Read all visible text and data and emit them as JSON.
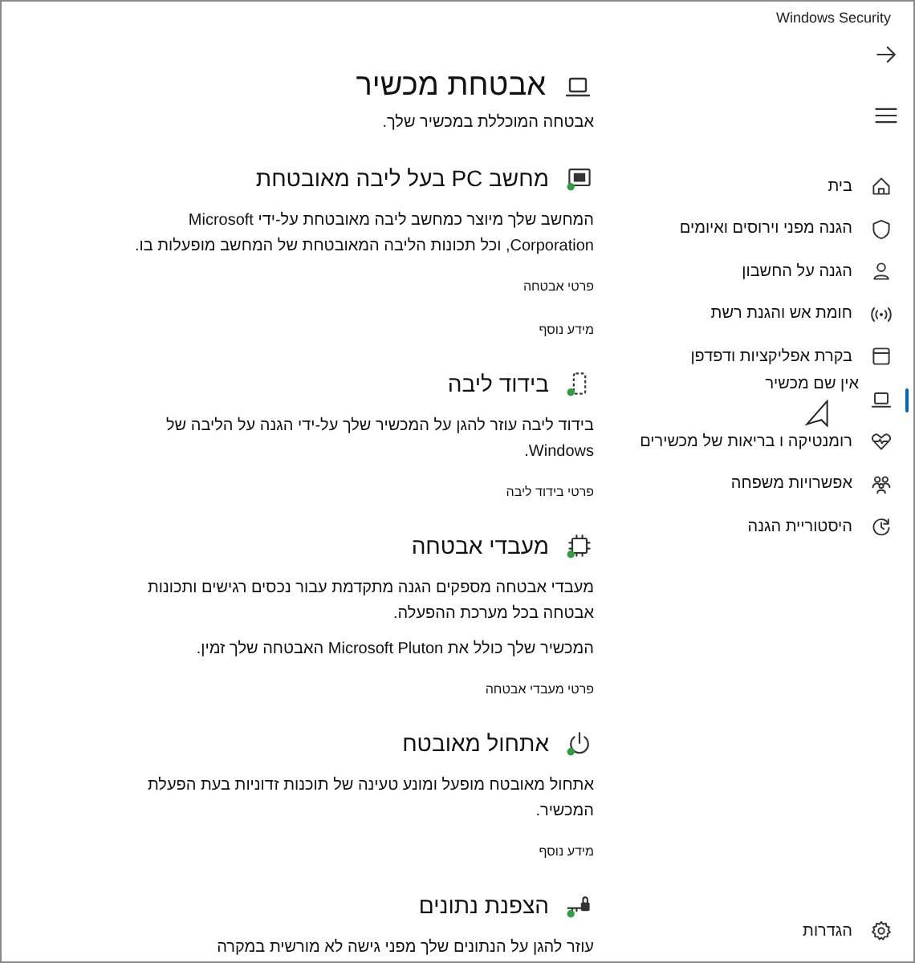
{
  "window": {
    "title": "Windows Security"
  },
  "nav": {
    "items": [
      {
        "label": "בית",
        "kind": "home",
        "selected": false
      },
      {
        "label": "הגנה מפני וירוסים ואיומים",
        "kind": "shield",
        "selected": false
      },
      {
        "label": "הגנה על החשבון",
        "kind": "person",
        "selected": false
      },
      {
        "label": "חומת אש והגנת רשת",
        "kind": "antenna",
        "selected": false
      },
      {
        "label": "בקרת אפליקציות ודפדפן",
        "kind": "window",
        "selected": false
      },
      {
        "kind": "laptop",
        "selected": true,
        "tooltip": "אין שם מכשיר"
      },
      {
        "label": "רומנטיקה ו בריאות של מכשירים",
        "kind": "heart",
        "selected": false
      },
      {
        "label": "אפשרויות משפחה",
        "kind": "family",
        "selected": false
      },
      {
        "label": "היסטוריית הגנה",
        "kind": "history",
        "selected": false
      }
    ],
    "settings": {
      "label": "הגדרות"
    }
  },
  "page": {
    "title": "אבטחת מכשיר",
    "subtitle": "אבטחה המוכללת במכשיר שלך."
  },
  "sections": [
    {
      "kind": "secure-pc",
      "title": "מחשב PC בעל ליבה מאובטחת",
      "paragraphs": [
        "המחשב שלך מיוצר כמחשב ליבה מאובטחת על-ידי Microsoft Corporation, וכל תכונות הליבה המאובטחת של המחשב מופעלות בו."
      ],
      "links": [
        "פרטי אבטחה",
        "מידע נוסף"
      ]
    },
    {
      "kind": "isolation",
      "title": "בידוד ליבה",
      "paragraphs": [
        "בידוד ליבה עוזר להגן על המכשיר שלך על-ידי הגנה על הליבה של Windows."
      ],
      "links": [
        "פרטי בידוד ליבה"
      ]
    },
    {
      "kind": "chip",
      "title": "מעבדי אבטחה",
      "paragraphs": [
        "מעבדי אבטחה מספקים הגנה מתקדמת עבור נכסים רגישים ותכונות אבטחה בכל מערכת ההפעלה.",
        "המכשיר שלך כולל את Microsoft Pluton האבטחה שלך זמין."
      ],
      "links": [
        "פרטי מעבדי אבטחה"
      ]
    },
    {
      "kind": "power",
      "title": "אתחול מאובטח",
      "paragraphs": [
        "אתחול מאובטח מופעל ומונע טעינה של תוכנות זדוניות בעת הפעלת המכשיר."
      ],
      "links": [
        "מידע נוסף"
      ]
    },
    {
      "kind": "key",
      "title": "הצפנת נתונים",
      "paragraphs": [
        "עוזר להגן על הנתונים שלך מפני גישה לא מורשית במקרה"
      ]
    }
  ]
}
